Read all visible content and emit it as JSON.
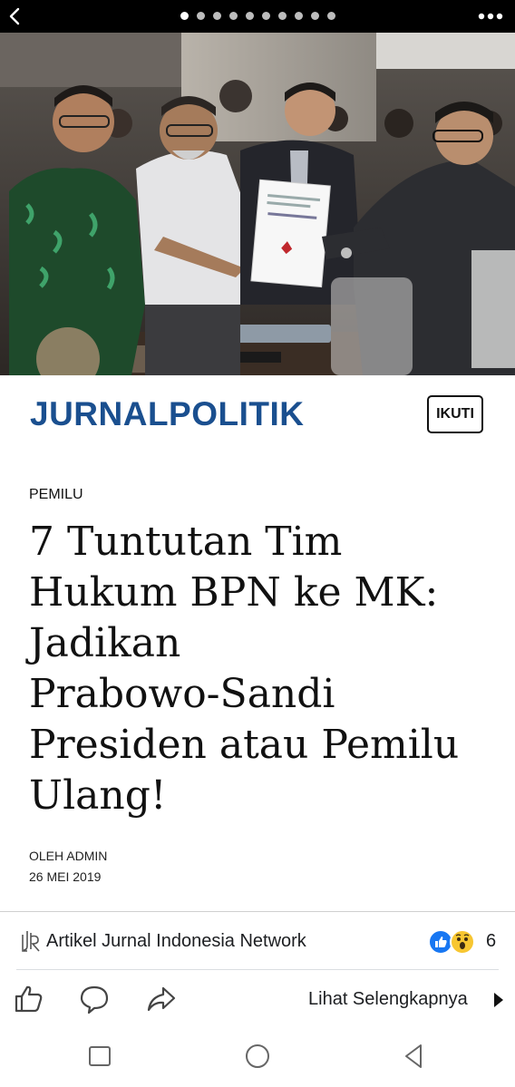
{
  "topbar": {
    "back_icon": "chevron-left-icon",
    "page_count": 10,
    "active_page": 1,
    "more_icon": "three-dots-icon"
  },
  "hero": {
    "image": "photo-handover-document"
  },
  "publisher": {
    "name": "JURNALPOLITIK",
    "follow_label": "IKUTI",
    "color": "#1a4f8f"
  },
  "article": {
    "category": "PEMILU",
    "title_lines": [
      "7 Tuntutan Tim",
      "Hukum BPN ke MK:",
      "Jadikan",
      "Prabowo-Sandi",
      "Presiden atau Pemilu",
      "Ulang!"
    ],
    "author": "OLEH ADMIN",
    "date": "26 MEI 2019"
  },
  "footer": {
    "network_icon": "instant-article-icon",
    "network_text": "Artikel Jurnal Indonesia Network",
    "reactions": [
      "like-reaction-icon",
      "wow-reaction-icon"
    ],
    "reaction_count": "6",
    "actions": [
      "like-icon",
      "comment-icon",
      "share-icon"
    ],
    "see_more_label": "Lihat Selengkapnya"
  },
  "system_nav": {
    "buttons": [
      "recent-apps-icon",
      "home-icon",
      "back-triangle-icon"
    ]
  }
}
